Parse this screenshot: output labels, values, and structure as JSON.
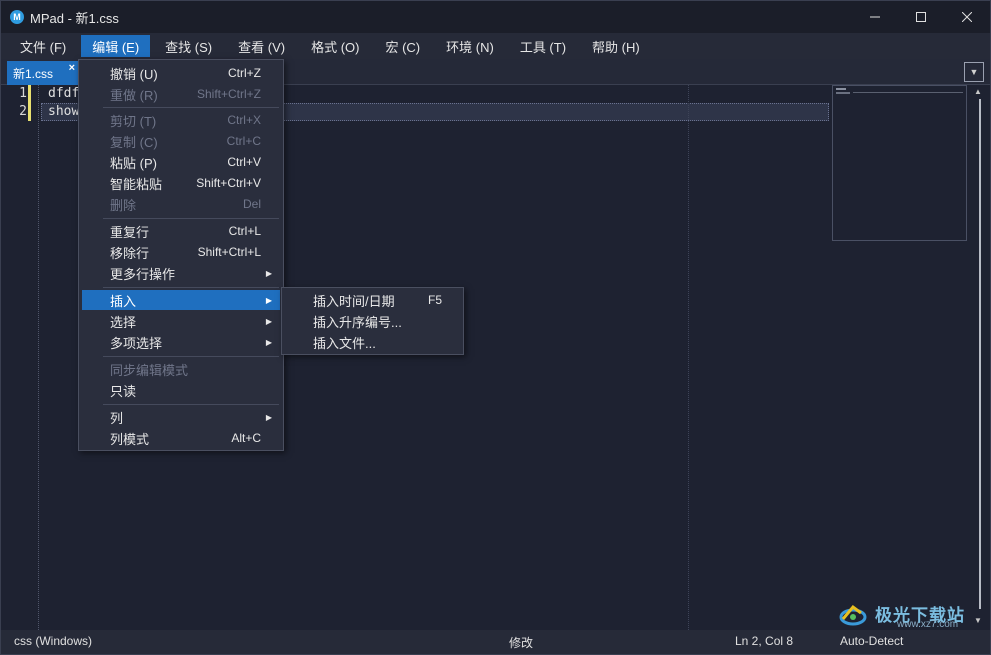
{
  "window": {
    "title": "MPad - 新1.css",
    "app_icon_letter": "M"
  },
  "menubar": {
    "items": [
      {
        "label": "文件 (F)"
      },
      {
        "label": "编辑 (E)"
      },
      {
        "label": "查找 (S)"
      },
      {
        "label": "查看 (V)"
      },
      {
        "label": "格式 (O)"
      },
      {
        "label": "宏 (C)"
      },
      {
        "label": "环境 (N)"
      },
      {
        "label": "工具 (T)"
      },
      {
        "label": "帮助 (H)"
      }
    ],
    "active_index": 1
  },
  "tabs": [
    {
      "label": "新1.css",
      "close": "×"
    }
  ],
  "editor": {
    "lines": [
      {
        "number": "1",
        "text": "dfdf"
      },
      {
        "number": "2",
        "text": "show"
      }
    ]
  },
  "edit_menu": {
    "items": [
      {
        "label": "撤销 (U)",
        "shortcut": "Ctrl+Z"
      },
      {
        "label": "重做 (R)",
        "shortcut": "Shift+Ctrl+Z"
      },
      {
        "label": "剪切 (T)",
        "shortcut": "Ctrl+X"
      },
      {
        "label": "复制 (C)",
        "shortcut": "Ctrl+C"
      },
      {
        "label": "粘贴 (P)",
        "shortcut": "Ctrl+V"
      },
      {
        "label": "智能粘贴",
        "shortcut": "Shift+Ctrl+V"
      },
      {
        "label": "删除",
        "shortcut": "Del"
      },
      {
        "label": "重复行",
        "shortcut": "Ctrl+L"
      },
      {
        "label": "移除行",
        "shortcut": "Shift+Ctrl+L"
      },
      {
        "label": "更多行操作",
        "shortcut": ""
      },
      {
        "label": "插入",
        "shortcut": ""
      },
      {
        "label": "选择",
        "shortcut": ""
      },
      {
        "label": "多项选择",
        "shortcut": ""
      },
      {
        "label": "同步编辑模式",
        "shortcut": ""
      },
      {
        "label": "只读",
        "shortcut": ""
      },
      {
        "label": "列",
        "shortcut": ""
      },
      {
        "label": "列模式",
        "shortcut": "Alt+C"
      }
    ]
  },
  "insert_submenu": {
    "items": [
      {
        "label": "插入时间/日期",
        "shortcut": "F5"
      },
      {
        "label": "插入升序编号...",
        "shortcut": ""
      },
      {
        "label": "插入文件...",
        "shortcut": ""
      }
    ]
  },
  "statusbar": {
    "file_type": "css (Windows)",
    "state": "修改",
    "position": "Ln 2, Col 8",
    "encoding": "Auto-Detect"
  },
  "watermark": {
    "text": "极光下载站",
    "url": "www.xz7.com"
  },
  "colors": {
    "accent": "#1f6fbf",
    "background": "#1e2231",
    "change_marker": "#e8e070"
  }
}
